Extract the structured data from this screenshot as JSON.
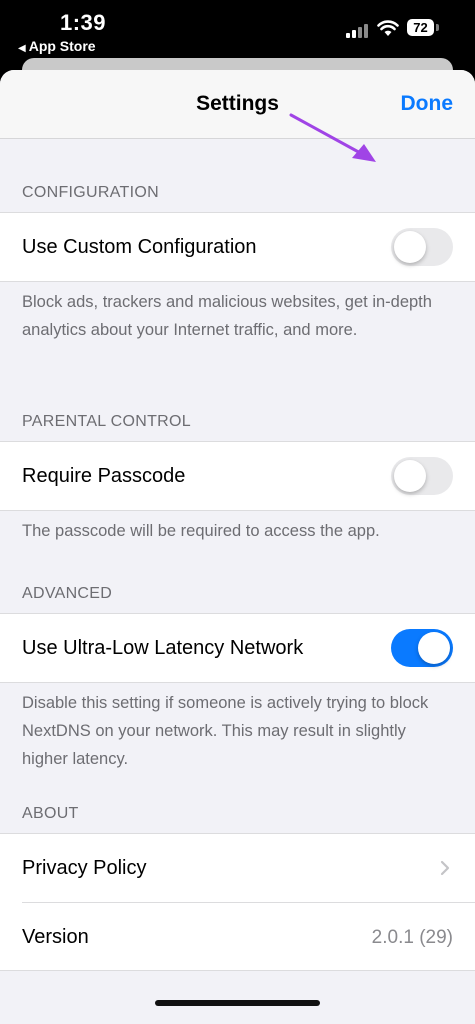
{
  "status_bar": {
    "time": "1:39",
    "back_label": "App Store",
    "battery": "72"
  },
  "nav": {
    "title": "Settings",
    "done_label": "Done"
  },
  "sections": {
    "configuration": {
      "header": "CONFIGURATION",
      "row_label": "Use Custom Configuration",
      "toggle_on": false,
      "footer": "Block ads, trackers and malicious websites, get in-depth analytics about your Internet traffic, and more."
    },
    "parental": {
      "header": "PARENTAL CONTROL",
      "row_label": "Require Passcode",
      "toggle_on": false,
      "footer": "The passcode will be required to access the app."
    },
    "advanced": {
      "header": "ADVANCED",
      "row_label": "Use Ultra-Low Latency Network",
      "toggle_on": true,
      "footer": "Disable this setting if someone is actively trying to block NextDNS on your network. This may result in slightly higher latency."
    },
    "about": {
      "header": "ABOUT",
      "privacy_label": "Privacy Policy",
      "version_label": "Version",
      "version_value": "2.0.1 (29)"
    }
  },
  "colors": {
    "accent": "#0a7aff",
    "annotation_arrow": "#a044e6"
  }
}
